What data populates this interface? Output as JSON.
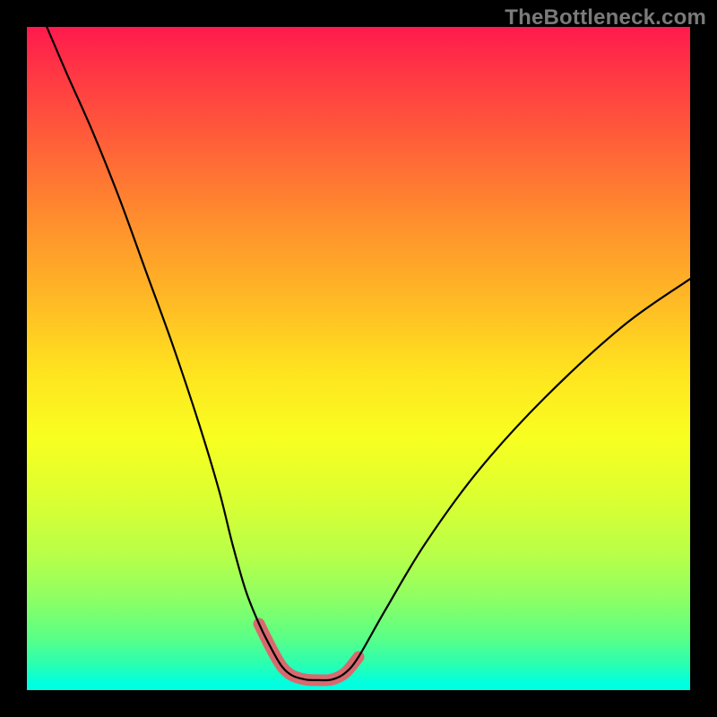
{
  "watermark": "TheBottleneck.com",
  "chart_data": {
    "type": "line",
    "title": "",
    "xlabel": "",
    "ylabel": "",
    "xlim": [
      0,
      100
    ],
    "ylim": [
      0,
      100
    ],
    "series": [
      {
        "name": "bottleneck-curve",
        "x": [
          3,
          6,
          10,
          14,
          18,
          22,
          26,
          29,
          31,
          33,
          35,
          37,
          38.5,
          40,
          42,
          44,
          46,
          48,
          50,
          54,
          60,
          68,
          78,
          90,
          100
        ],
        "values": [
          100,
          93,
          84,
          74,
          63,
          52,
          40,
          30,
          22,
          15,
          10,
          6,
          3.5,
          2.2,
          1.6,
          1.5,
          1.6,
          2.6,
          5,
          12,
          22,
          33,
          44,
          55,
          62
        ]
      }
    ],
    "highlighted_segment": {
      "name": "optimal-range",
      "x_start": 35,
      "x_end": 50,
      "color": "#d86a6f"
    },
    "gradient_stops": [
      {
        "pos": 0,
        "color": "#ff1a4d"
      },
      {
        "pos": 50,
        "color": "#ffe31f"
      },
      {
        "pos": 100,
        "color": "#00ffe0"
      }
    ]
  }
}
